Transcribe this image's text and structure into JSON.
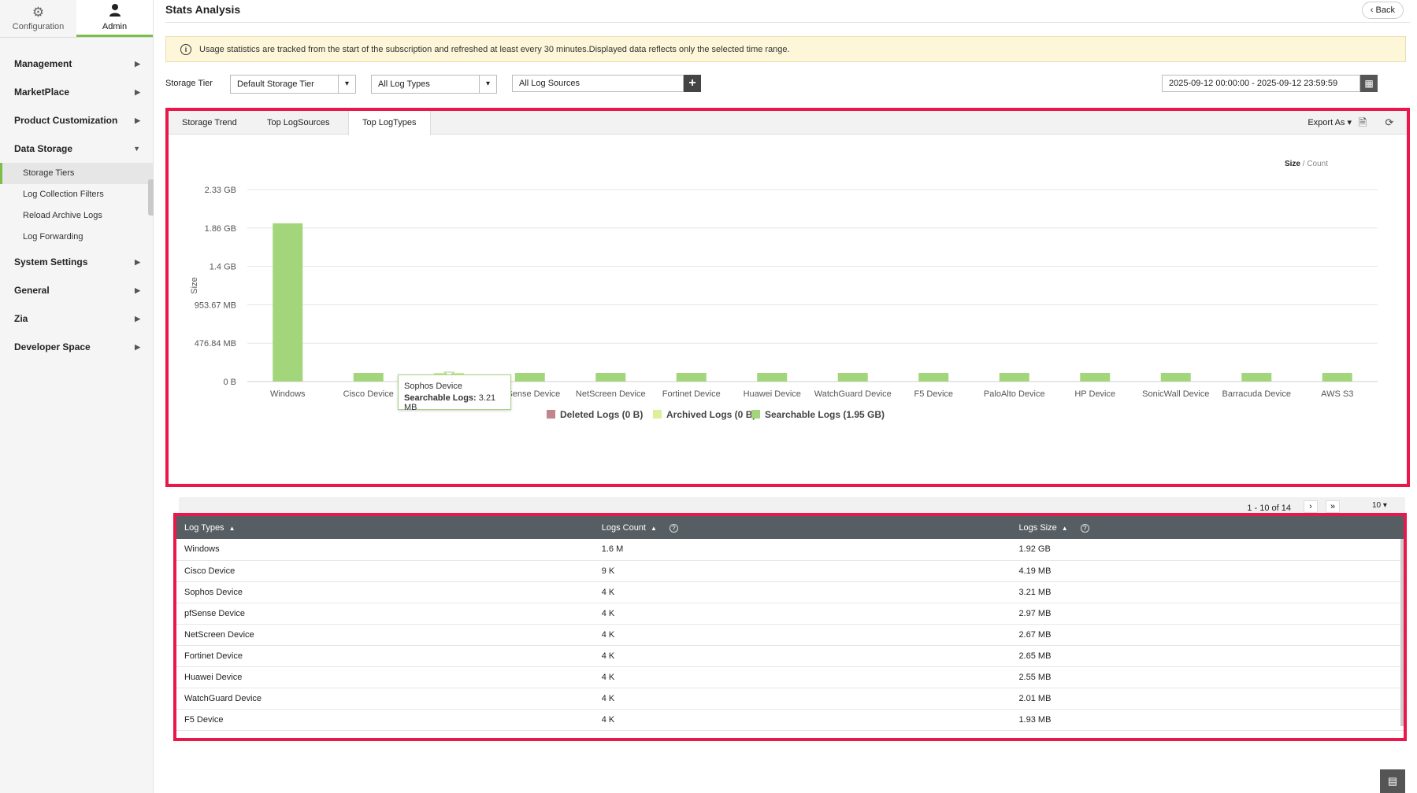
{
  "sidebar": {
    "top_tabs": [
      {
        "label": "Configuration",
        "icon": "gear-icon"
      },
      {
        "label": "Admin",
        "icon": "user-icon"
      }
    ],
    "items": [
      {
        "label": "Management"
      },
      {
        "label": "MarketPlace"
      },
      {
        "label": "Product Customization"
      },
      {
        "label": "Data Storage"
      },
      {
        "label": "System Settings"
      },
      {
        "label": "General"
      },
      {
        "label": "Zia"
      },
      {
        "label": "Developer Space"
      }
    ],
    "sub_items": [
      {
        "label": "Storage Tiers"
      },
      {
        "label": "Log Collection Filters"
      },
      {
        "label": "Reload Archive Logs"
      },
      {
        "label": "Log Forwarding"
      }
    ]
  },
  "header": {
    "title": "Stats Analysis",
    "back_label": "Back"
  },
  "notice": {
    "text": "Usage statistics are tracked from the start of the subscription and refreshed at least every 30 minutes.Displayed data reflects only the selected time range."
  },
  "filters": {
    "storage_tier_label": "Storage Tier",
    "storage_tier_value": "Default Storage Tier",
    "log_types_value": "All Log Types",
    "log_sources_value": "All Log Sources",
    "date_range": "2025-09-12 00:00:00 - 2025-09-12 23:59:59"
  },
  "chart_tabs": [
    {
      "label": "Storage Trend"
    },
    {
      "label": "Top LogSources"
    },
    {
      "label": "Top LogTypes"
    }
  ],
  "toolbar": {
    "export_label": "Export As",
    "size_label": "Size",
    "count_label": "Count"
  },
  "tooltip": {
    "title": "Sophos Device",
    "label": "Searchable Logs:",
    "value": "3.21 MB"
  },
  "chart_data": {
    "type": "bar",
    "ylabel": "Size",
    "y_ticks": [
      "0 B",
      "476.84 MB",
      "953.67 MB",
      "1.4 GB",
      "1.86 GB",
      "2.33 GB"
    ],
    "ylim_mb": [
      0,
      2384.19
    ],
    "categories": [
      "Windows",
      "Cisco Device",
      "Sophos Device",
      "pfSense Device",
      "NetScreen Device",
      "Fortinet Device",
      "Huawei Device",
      "WatchGuard Device",
      "F5 Device",
      "PaloAlto Device",
      "HP Device",
      "SonicWall Device",
      "Barracuda Device",
      "AWS S3"
    ],
    "series": [
      {
        "name": "Deleted Logs (0 B)",
        "color": "#c0858d",
        "values": [
          0,
          0,
          0,
          0,
          0,
          0,
          0,
          0,
          0,
          0,
          0,
          0,
          0,
          0
        ]
      },
      {
        "name": "Archived Logs (0 B)",
        "color": "#dcef9a",
        "values": [
          0,
          0,
          0,
          0,
          0,
          0,
          0,
          0,
          0,
          0,
          0,
          0,
          0,
          0
        ]
      },
      {
        "name": "Searchable Logs (1.95 GB)",
        "color": "#a3d67b",
        "values": [
          1966.08,
          4.19,
          3.21,
          2.97,
          2.67,
          2.65,
          2.55,
          2.01,
          1.93,
          1.9,
          1.8,
          1.7,
          1.6,
          1.5
        ]
      }
    ],
    "highlight_color": "#cfec8f",
    "highlight_index": 2,
    "grid": true,
    "legend": "bottom"
  },
  "pager": {
    "text": "1 - 10 of 14",
    "per_page": "10"
  },
  "table": {
    "columns": [
      "Log Types",
      "Logs Count",
      "Logs Size"
    ],
    "rows": [
      [
        "Windows",
        "1.6 M",
        "1.92 GB"
      ],
      [
        "Cisco Device",
        "9 K",
        "4.19 MB"
      ],
      [
        "Sophos Device",
        "4 K",
        "3.21 MB"
      ],
      [
        "pfSense Device",
        "4 K",
        "2.97 MB"
      ],
      [
        "NetScreen Device",
        "4 K",
        "2.67 MB"
      ],
      [
        "Fortinet Device",
        "4 K",
        "2.65 MB"
      ],
      [
        "Huawei Device",
        "4 K",
        "2.55 MB"
      ],
      [
        "WatchGuard Device",
        "4 K",
        "2.01 MB"
      ],
      [
        "F5 Device",
        "4 K",
        "1.93 MB"
      ]
    ]
  }
}
